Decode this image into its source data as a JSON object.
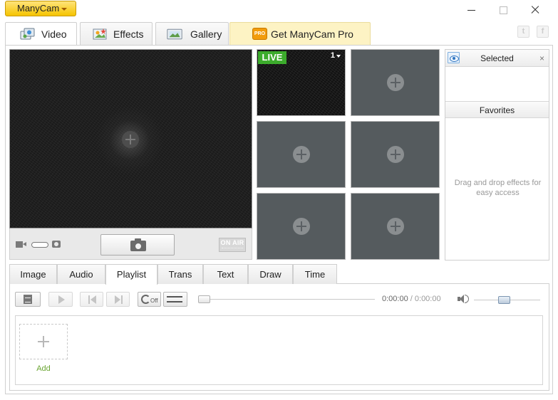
{
  "app": {
    "menu_label": "ManyCam"
  },
  "top_tabs": [
    {
      "label": "Video",
      "icon": "video-sources-icon",
      "active": true
    },
    {
      "label": "Effects",
      "icon": "effects-icon",
      "active": false
    },
    {
      "label": "Gallery",
      "icon": "gallery-icon",
      "active": false
    },
    {
      "label": "Get ManyCam Pro",
      "icon": "pro-badge-icon",
      "active": false
    }
  ],
  "social": {
    "twitter": "t",
    "facebook": "f"
  },
  "pro_badge_text": "PRO",
  "preview_bar": {
    "on_air_label": "ON AIR"
  },
  "sources": {
    "live_label": "LIVE",
    "live_channel": "1"
  },
  "effects_panel": {
    "selected_label": "Selected",
    "close_glyph": "×",
    "favorites_label": "Favorites",
    "favorites_hint": "Drag and drop effects for easy access"
  },
  "bottom_tabs": [
    {
      "label": "Image",
      "active": false
    },
    {
      "label": "Audio",
      "active": false
    },
    {
      "label": "Playlist",
      "active": true
    },
    {
      "label": "Trans",
      "active": false
    },
    {
      "label": "Text",
      "active": false
    },
    {
      "label": "Draw",
      "active": false
    },
    {
      "label": "Time",
      "active": false
    }
  ],
  "playlist": {
    "loop_state": "Off",
    "current_time": "0:00:00",
    "time_separator": "/",
    "total_time": "0:00:00",
    "add_label": "Add",
    "seek_position": 0,
    "volume_level": 0.45
  },
  "colors": {
    "accent_yellow": "#f5c400",
    "live_green": "#3cab2c",
    "add_green": "#6aa532",
    "source_tile": "#555b5e"
  }
}
